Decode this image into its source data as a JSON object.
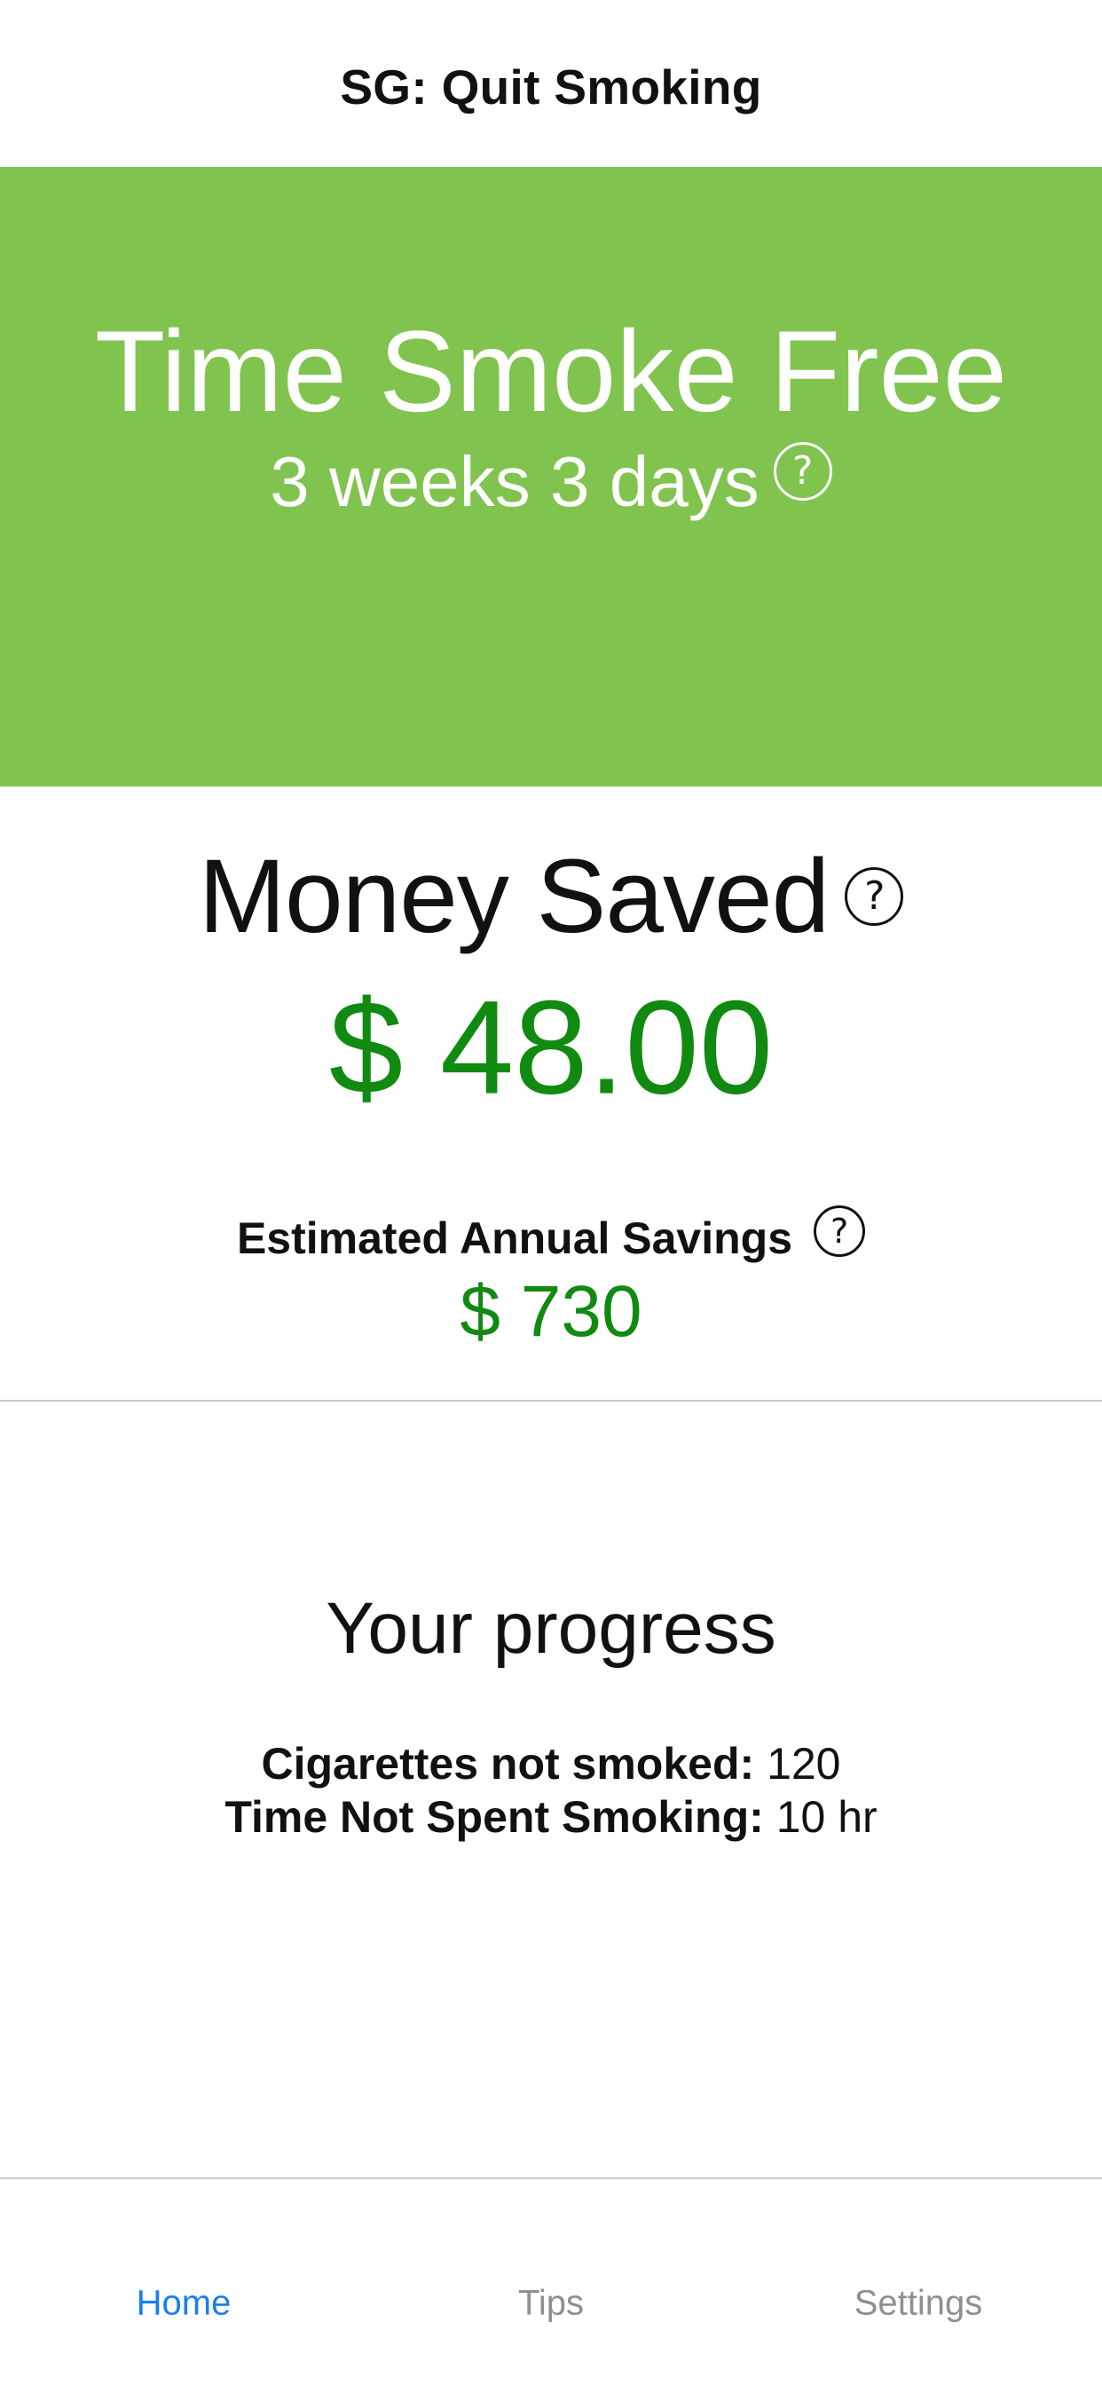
{
  "nav": {
    "title": "SG: Quit Smoking"
  },
  "hero": {
    "title": "Time Smoke Free",
    "duration": "3 weeks 3 days",
    "help_glyph": "?",
    "background_color": "#80c34e"
  },
  "money": {
    "title": "Money Saved",
    "help_glyph": "?",
    "value": "$ 48.00",
    "value_color": "#118a11"
  },
  "annual": {
    "label": "Estimated Annual Savings",
    "help_glyph": "?",
    "value": "$ 730"
  },
  "progress": {
    "title": "Your progress",
    "cigarettes_label": "Cigarettes not smoked:",
    "cigarettes_value": "120",
    "time_label": "Time Not Spent Smoking:",
    "time_value": "10 hr"
  },
  "tabs": [
    {
      "label": "Home",
      "active": true
    },
    {
      "label": "Tips",
      "active": false
    },
    {
      "label": "Settings",
      "active": false
    }
  ],
  "colors": {
    "accent": "#1a7ef2",
    "inactive_tab": "#8e8e93",
    "money_green": "#118a11",
    "hero_green": "#80c34e"
  }
}
